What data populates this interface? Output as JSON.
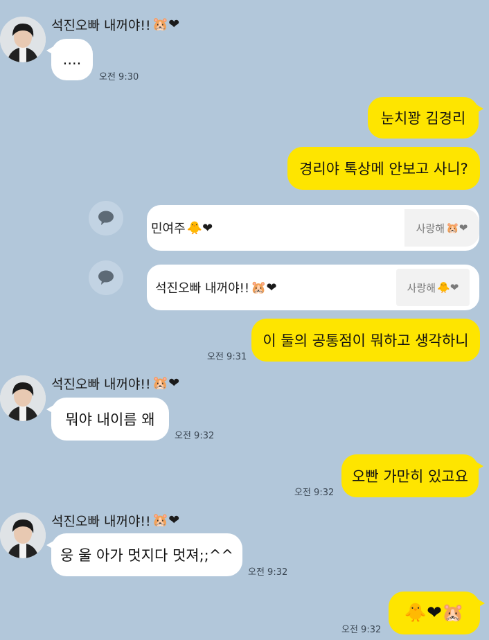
{
  "contact": {
    "name": "석진오빠 내꺼야!!",
    "name_emoji": "🐹❤"
  },
  "messages": [
    {
      "from": "other",
      "text": "....",
      "time": "오전 9:30"
    },
    {
      "from": "me",
      "text": "눈치꽝 김경리"
    },
    {
      "from": "me",
      "text": "경리야 톡상메 안보고 사니?"
    },
    {
      "from": "me",
      "type": "profile",
      "name": "민여주",
      "name_emoji": "🐥❤",
      "status": "사랑해",
      "status_emoji": "🐹❤"
    },
    {
      "from": "me",
      "type": "profile",
      "name": "석진오빠 내꺼야!!",
      "name_emoji": "🐹❤",
      "status": "사랑해",
      "status_emoji": "🐥❤"
    },
    {
      "from": "me",
      "text": "이 둘의 공통점이 뭐하고 생각하니",
      "time": "오전 9:31"
    },
    {
      "from": "other",
      "text": "뭐야 내이름 왜",
      "time": "오전 9:32"
    },
    {
      "from": "me",
      "text": "오빤 가만히 있고요",
      "time": "오전 9:32"
    },
    {
      "from": "other",
      "text": "웅 울 아가 멋지다 멋져;;^^",
      "time": "오전 9:32"
    },
    {
      "from": "me",
      "text": "🐥❤🐹",
      "time": "오전 9:32"
    }
  ],
  "icons": {
    "avatar": "profile-photo",
    "share": "speech-bubble-icon"
  },
  "colors": {
    "background": "#b2c7da",
    "my_bubble": "#fee500",
    "their_bubble": "#ffffff"
  }
}
